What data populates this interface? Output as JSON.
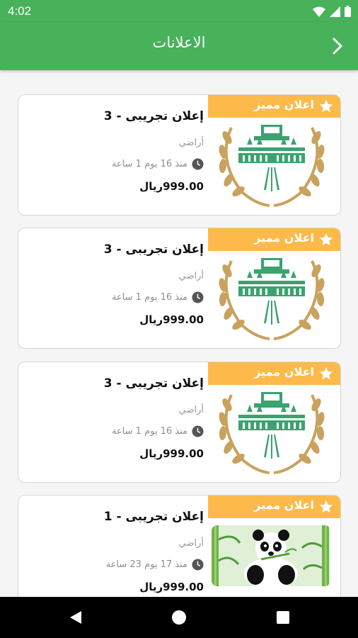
{
  "status_bar": {
    "time": "4:02"
  },
  "app_bar": {
    "title": "الاعلانات",
    "back_icon": "chevron-right-icon"
  },
  "colors": {
    "primary": "#47b25a",
    "badge": "#fdba4a",
    "logo_green": "#3aa36f",
    "logo_gold": "#c9a25e"
  },
  "ads": [
    {
      "badge": "اعلان مميز",
      "title": "إعلان تجريبى - 3",
      "category": "أراضي",
      "time": "منذ 16 يوم 1 ساعة",
      "price": "999.00ريال",
      "image": "logo"
    },
    {
      "badge": "اعلان مميز",
      "title": "إعلان تجريبى - 3",
      "category": "أراضي",
      "time": "منذ 16 يوم 1 ساعة",
      "price": "999.00ريال",
      "image": "logo"
    },
    {
      "badge": "اعلان مميز",
      "title": "إعلان تجريبى - 3",
      "category": "أراضي",
      "time": "منذ 16 يوم 1 ساعة",
      "price": "999.00ريال",
      "image": "logo"
    },
    {
      "badge": "اعلان مميز",
      "title": "إعلان تجريبى - 1",
      "category": "أراضي",
      "time": "منذ 17 يوم 23 ساعة",
      "price": "999.00ريال",
      "image": "panda"
    }
  ],
  "nav_bar": {
    "back": "back-triangle-icon",
    "home": "home-circle-icon",
    "recents": "recents-square-icon"
  }
}
